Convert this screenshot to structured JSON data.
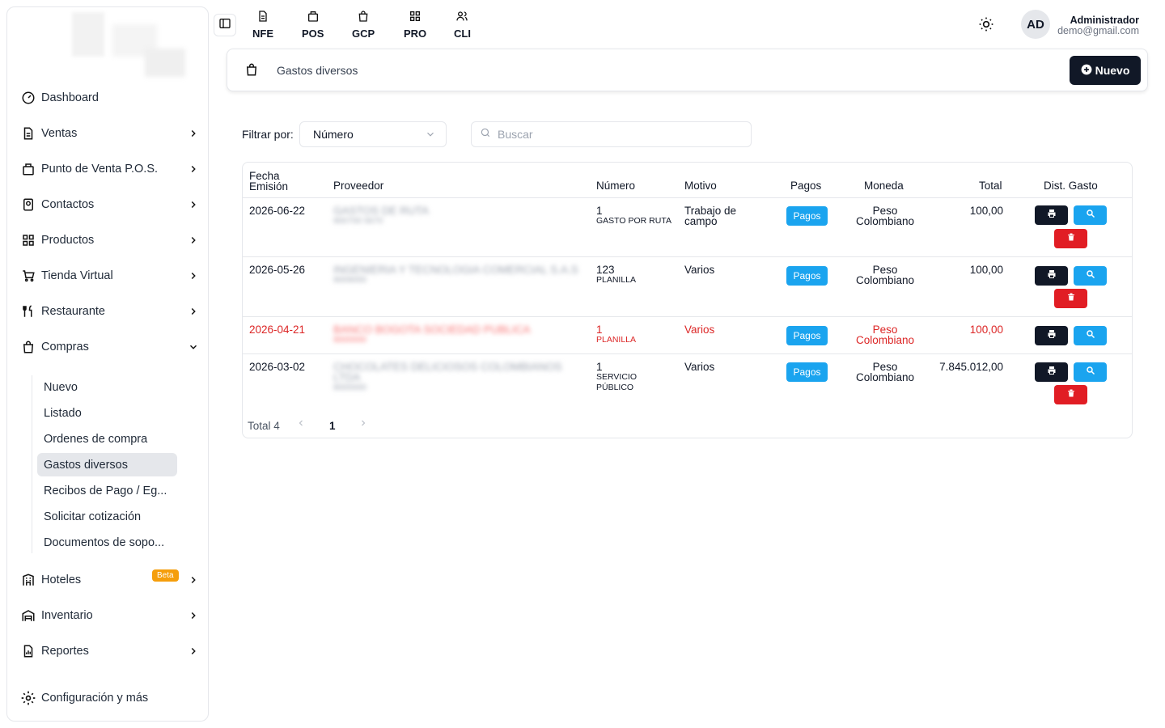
{
  "sidebar": {
    "items": [
      {
        "label": "Dashboard"
      },
      {
        "label": "Ventas"
      },
      {
        "label": "Punto de Venta P.O.S."
      },
      {
        "label": "Contactos"
      },
      {
        "label": "Productos"
      },
      {
        "label": "Tienda Virtual"
      },
      {
        "label": "Restaurante"
      },
      {
        "label": "Compras"
      },
      {
        "label": "Hoteles"
      },
      {
        "label": "Inventario"
      },
      {
        "label": "Reportes"
      },
      {
        "label": "Configuración y más"
      }
    ],
    "compras_sub": [
      {
        "label": "Nuevo"
      },
      {
        "label": "Listado"
      },
      {
        "label": "Ordenes de compra"
      },
      {
        "label": "Gastos diversos"
      },
      {
        "label": "Recibos de Pago / Eg..."
      },
      {
        "label": "Solicitar cotización"
      },
      {
        "label": "Documentos de sopo..."
      }
    ],
    "beta_badge": "Beta"
  },
  "topbar": {
    "shortcuts": [
      {
        "label": "NFE"
      },
      {
        "label": "POS"
      },
      {
        "label": "GCP"
      },
      {
        "label": "PRO"
      },
      {
        "label": "CLI"
      }
    ],
    "avatar_initials": "AD",
    "user_name": "Administrador",
    "user_email": "demo@gmail.com"
  },
  "header": {
    "title": "Gastos diversos",
    "new_button": "Nuevo"
  },
  "filters": {
    "filter_label": "Filtrar por:",
    "selected": "Número",
    "search_placeholder": "Buscar"
  },
  "table": {
    "headers": {
      "fecha": "Fecha Emisión",
      "proveedor": "Proveedor",
      "numero": "Número",
      "motivo": "Motivo",
      "pagos": "Pagos",
      "moneda": "Moneda",
      "total": "Total",
      "dist": "Dist. Gasto"
    },
    "rows": [
      {
        "fecha": "2026-06-22",
        "proveedor": "GASTOS DE RUTA",
        "proveedor_sub": "900700 5670",
        "numero": "1",
        "serie": "GASTO POR RUTA",
        "motivo": "Trabajo de campo",
        "pagos": "Pagos",
        "moneda": "Peso Colombiano",
        "total": "100,00"
      },
      {
        "fecha": "2026-05-26",
        "proveedor": "INGENIERIA Y TECNOLOGIA COMERCIAL S.A.S",
        "proveedor_sub": "9009000",
        "numero": "123",
        "serie": "PLANILLA",
        "motivo": "Varios",
        "pagos": "Pagos",
        "moneda": "Peso Colombiano",
        "total": "100,00"
      },
      {
        "fecha": "2026-04-21",
        "proveedor": "BANCO BOGOTA SOCIEDAD PUBLICA",
        "proveedor_sub": "9000000",
        "numero": "1",
        "serie": "PLANILLA",
        "motivo": "Varios",
        "pagos": "Pagos",
        "moneda": "Peso Colombiano",
        "total": "100,00"
      },
      {
        "fecha": "2026-03-02",
        "proveedor": "CHOCOLATES DELICIOSOS COLOMBIANOS LTDA",
        "proveedor_sub": "8000000",
        "numero": "1",
        "serie": "SERVICIO PÚBLICO",
        "motivo": "Varios",
        "pagos": "Pagos",
        "moneda": "Peso Colombiano",
        "total": "7.845.012,00"
      }
    ]
  },
  "pagination": {
    "total": "Total 4",
    "page": "1"
  },
  "colors": {
    "primary_dark": "#111827",
    "accent_blue": "#1aa4ef",
    "danger_red": "#e11d24",
    "beta_orange": "#f59e0b"
  }
}
